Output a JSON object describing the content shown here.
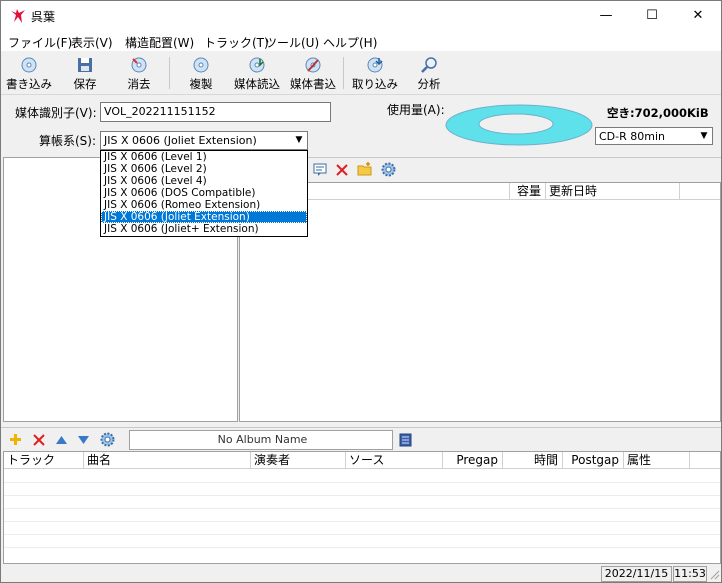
{
  "window": {
    "title": "呉葉",
    "minimize": "—",
    "maximize": "☐",
    "close": "✕"
  },
  "menu": [
    "ファイル(F)",
    "表示(V)",
    "構造配置(W)",
    "トラック(T)",
    "ツール(U)",
    "ヘルプ(H)"
  ],
  "toolbar": {
    "write": "書き込み",
    "save": "保存",
    "erase": "消去",
    "copy": "複製",
    "read_media": "媒体読込",
    "write_media": "媒体書込",
    "import": "取り込み",
    "analyze": "分析"
  },
  "form": {
    "volume_id_label": "媒体識別子(V):",
    "volume_id_value": "VOL_202211151152",
    "filesystem_label": "算帳系(S):",
    "filesystem_value": "JIS X 0606 (Joliet Extension)",
    "usage_label": "使用量(A):",
    "free_space": "空き:702,000KiB",
    "media_type": "CD-R 80min"
  },
  "filesystem_options": [
    "JIS X 0606 (Level 1)",
    "JIS X 0606 (Level 2)",
    "JIS X 0606 (Level 4)",
    "JIS X 0606 (DOS Compatible)",
    "JIS X 0606 (Romeo Extension)",
    "JIS X 0606 (Joliet Extension)",
    "JIS X 0606 (Joliet+ Extension)"
  ],
  "file_columns": {
    "size": "容量",
    "modified": "更新日時"
  },
  "album": {
    "name": "No Album Name"
  },
  "track_columns": [
    "トラック",
    "曲名",
    "演奏者",
    "ソース",
    "Pregap",
    "時間",
    "Postgap",
    "属性"
  ],
  "status": {
    "date": "2022/11/15",
    "time": "11:53"
  },
  "colors": {
    "accent": "#0078d7",
    "disc": "#5ee1ea"
  }
}
